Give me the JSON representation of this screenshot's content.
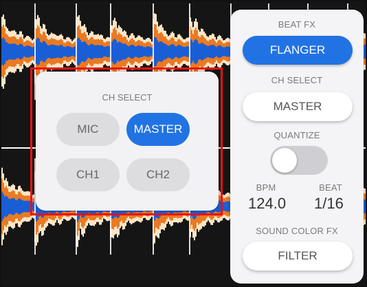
{
  "colors": {
    "accent_blue": "#2173e3",
    "wave_orange": "#ea7a22",
    "wave_blue": "#1a5ed6",
    "wave_cream": "#fbe6c8",
    "highlight_red": "#ee1111"
  },
  "fx_panel": {
    "beat_fx_label": "BEAT FX",
    "beat_fx_value": "FLANGER",
    "ch_select_label": "CH SELECT",
    "ch_select_value": "MASTER",
    "quantize_label": "QUANTIZE",
    "quantize_on": false,
    "bpm_label": "BPM",
    "bpm_value": "124.0",
    "beat_label": "BEAT",
    "beat_value": "1/16",
    "sound_color_label": "SOUND COLOR FX",
    "sound_color_value": "FILTER"
  },
  "ch_select_popup": {
    "title": "CH SELECT",
    "options": [
      "MIC",
      "MASTER",
      "CH1",
      "CH2"
    ],
    "selected": "MASTER"
  }
}
